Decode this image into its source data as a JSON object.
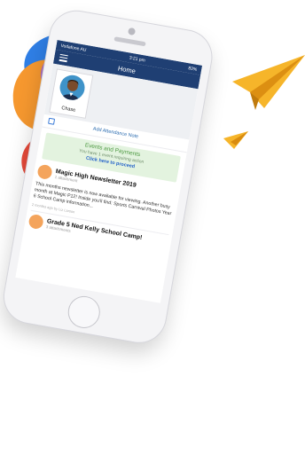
{
  "colors": {
    "header": "#1f3f73",
    "events_bg": "#e3f3df",
    "events_title": "#4f9a44",
    "link": "#2563c9",
    "plane_yellow": "#f6b52a"
  },
  "status": {
    "carrier": "Vodafone AU",
    "time": "3:21 pm",
    "battery": "83%"
  },
  "nav": {
    "menu_icon": "hamburger-icon",
    "title": "Home"
  },
  "student": {
    "name": "Chase"
  },
  "attendance": {
    "icon": "calendar-icon",
    "label": "Add Attendance Note"
  },
  "events": {
    "title": "Events and Payments",
    "subtitle": "You have 1 event requiring action",
    "link": "Click here to proceed"
  },
  "news": [
    {
      "title": "Magic High Newsletter 2019",
      "subtitle": "1 attachment",
      "body": "This months newsletter is now available for viewing. Another busy month at Magic P12! Inside you'll find: Sports Carnival Photos Year 6 School Camp information...",
      "meta": "2 months ago by Liz Larson"
    },
    {
      "title": "Grade 5 Ned Kelly School Camp!",
      "subtitle": "3 attachments"
    }
  ]
}
